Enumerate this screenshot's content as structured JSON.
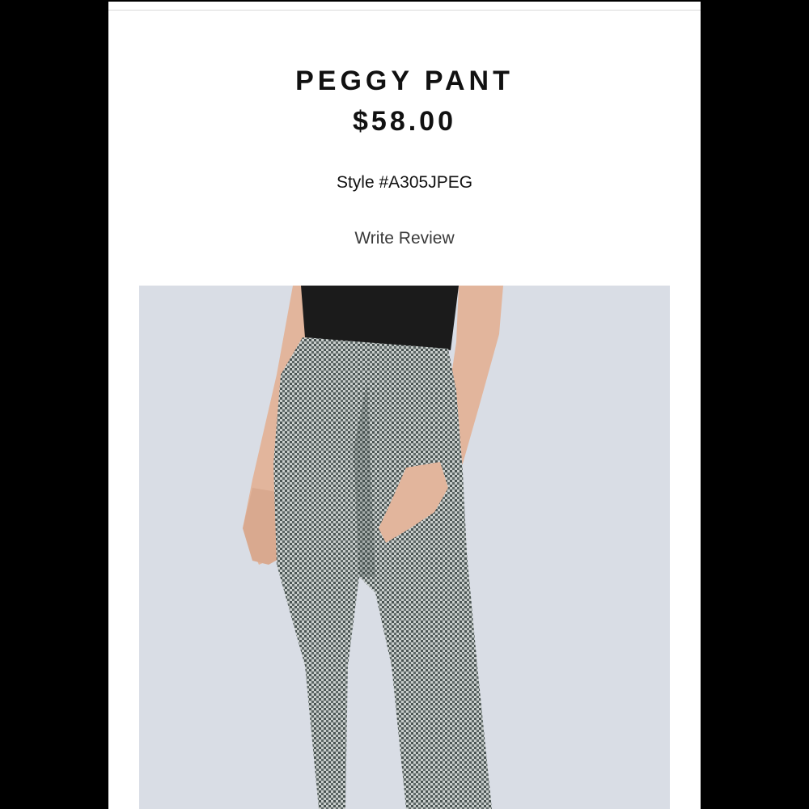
{
  "product": {
    "name": "PEGGY PANT",
    "price": "$58.00",
    "style": "Style #A305JPEG",
    "write_review_label": "Write Review"
  },
  "image": {
    "icon": "product-photo-icon",
    "background_color": "#d9dde5",
    "garment_color": "#8a9190",
    "top_color": "#1b1b1b",
    "skin_color": "#e2b59c"
  }
}
